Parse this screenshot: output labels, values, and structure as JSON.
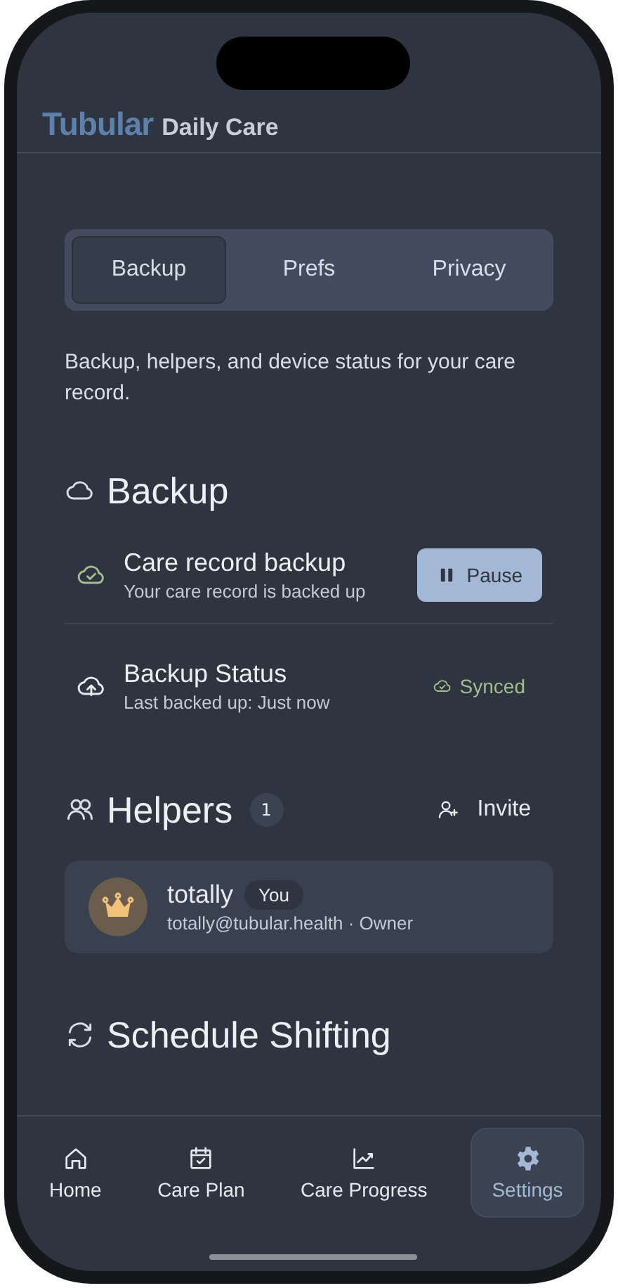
{
  "header": {
    "brand": "Tubular",
    "title": "Daily Care"
  },
  "tabs": [
    {
      "label": "Backup",
      "selected": true
    },
    {
      "label": "Prefs",
      "selected": false
    },
    {
      "label": "Privacy",
      "selected": false
    }
  ],
  "intro": "Backup, helpers, and device status for your care record.",
  "sections": [
    {
      "kind": "backup",
      "title": "Backup",
      "rows": [
        {
          "kind": "toggle",
          "title": "Care record backup",
          "subtitle": "Your care record is backed up",
          "button": "Pause"
        },
        {
          "kind": "status",
          "title": "Backup Status",
          "subtitle": "Last backed up: Just now",
          "status": "Synced"
        }
      ]
    },
    {
      "kind": "helpers",
      "title": "Helpers",
      "count": "1",
      "action": "Invite",
      "members": [
        {
          "name": "totally",
          "badge": "You",
          "detail": "totally@tubular.health · Owner"
        }
      ]
    },
    {
      "kind": "schedule",
      "title": "Schedule Shifting"
    }
  ],
  "nav": [
    {
      "kind": "home",
      "label": "Home",
      "selected": false
    },
    {
      "kind": "plan",
      "label": "Care Plan",
      "selected": false
    },
    {
      "kind": "progress",
      "label": "Care Progress",
      "selected": false
    },
    {
      "kind": "settings",
      "label": "Settings",
      "selected": true
    }
  ]
}
